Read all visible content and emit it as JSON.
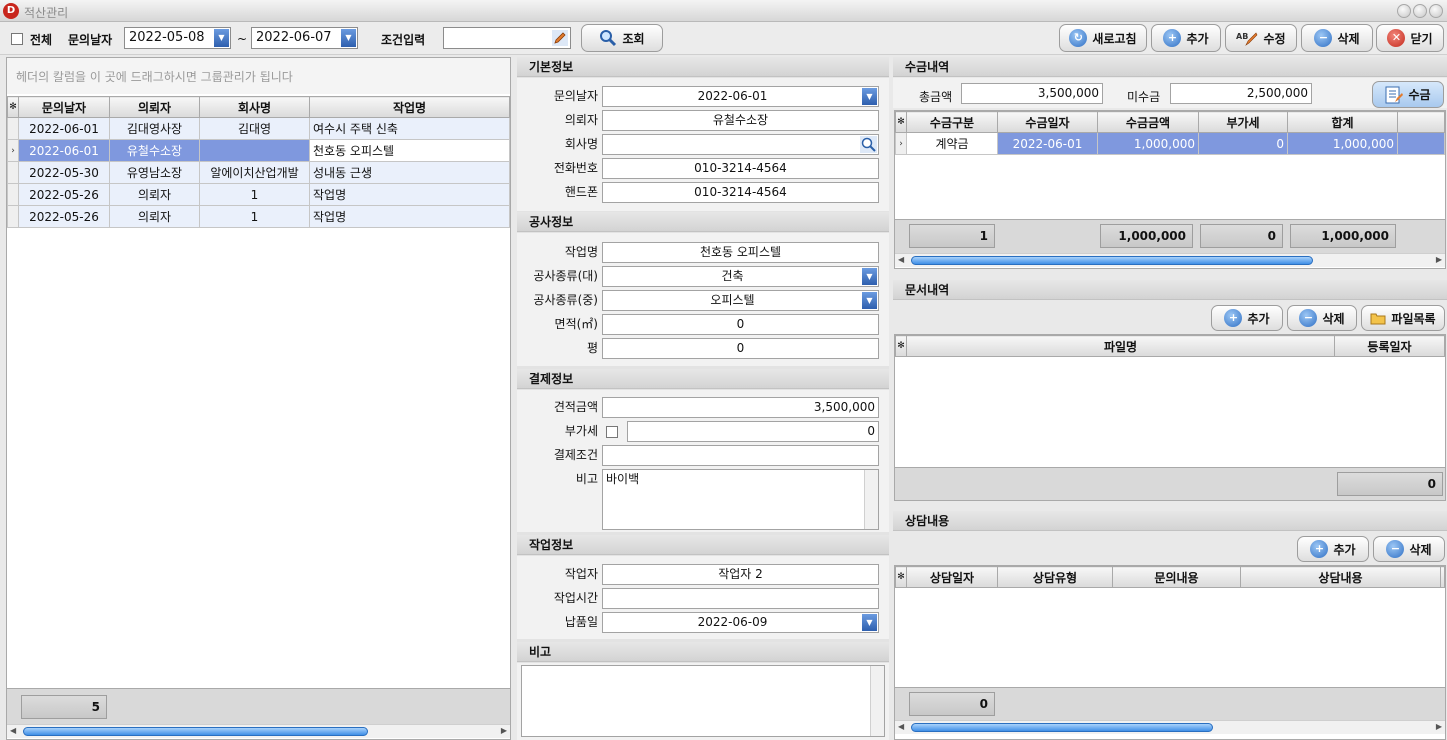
{
  "window": {
    "title": "적산관리",
    "app_letter": "D"
  },
  "toolbar": {
    "all_label": "전체",
    "date_label": "문의날자",
    "date_from": "2022-05-08",
    "tilde": "~",
    "date_to": "2022-06-07",
    "cond_label": "조건입력",
    "cond_value": "",
    "search_label": "조회",
    "refresh_label": "새로고침",
    "add_label": "추가",
    "edit_label": "수정",
    "delete_label": "삭제",
    "close_label": "닫기"
  },
  "left": {
    "group_hint": "헤더의 칼럼을 이 곳에 드래그하시면 그룹관리가 됩니다",
    "columns": [
      "문의날자",
      "의뢰자",
      "회사명",
      "작업명"
    ],
    "rows": [
      [
        "2022-06-01",
        "김대영사장",
        "김대영",
        "여수시 주택 신축"
      ],
      [
        "2022-06-01",
        "유철수소장",
        "",
        "천호동 오피스텔"
      ],
      [
        "2022-05-30",
        "유영남소장",
        "알에이치산업개발",
        "성내동 근생"
      ],
      [
        "2022-05-26",
        "의뢰자",
        "1",
        "작업명"
      ],
      [
        "2022-05-26",
        "의뢰자",
        "1",
        "작업명"
      ]
    ],
    "selected_index": 1,
    "count": "5"
  },
  "basic": {
    "header": "기본정보",
    "date_label": "문의날자",
    "date": "2022-06-01",
    "client_label": "의뢰자",
    "client": "유철수소장",
    "company_label": "회사명",
    "company": "",
    "phone_label": "전화번호",
    "phone": "010-3214-4564",
    "mobile_label": "핸드폰",
    "mobile": "010-3214-4564"
  },
  "construction": {
    "header": "공사정보",
    "job_label": "작업명",
    "job": "천호동 오피스텔",
    "type_major_label": "공사종류(대)",
    "type_major": "건축",
    "type_mid_label": "공사종류(중)",
    "type_mid": "오피스텔",
    "area_label": "면적(㎡)",
    "area": "0",
    "pyeong_label": "평",
    "pyeong": "0"
  },
  "payment": {
    "header": "결제정보",
    "estimate_label": "견적금액",
    "estimate": "3,500,000",
    "vat_label": "부가세",
    "vat": "0",
    "terms_label": "결제조건",
    "terms": "",
    "note_label": "비고",
    "note": "바이백"
  },
  "work": {
    "header": "작업정보",
    "worker_label": "작업자",
    "worker": "작업자 2",
    "time_label": "작업시간",
    "time": "",
    "delivery_label": "납품일",
    "delivery": "2022-06-09"
  },
  "remarks": {
    "header": "비고",
    "text": ""
  },
  "collection": {
    "header": "수금내역",
    "total_label": "총금액",
    "total": "3,500,000",
    "unpaid_label": "미수금",
    "unpaid": "2,500,000",
    "button_label": "수금",
    "columns": [
      "수금구분",
      "수금일자",
      "수금금액",
      "부가세",
      "합계"
    ],
    "rows": [
      [
        "계약금",
        "2022-06-01",
        "1,000,000",
        "0",
        "1,000,000"
      ]
    ],
    "footer": [
      "1",
      "1,000,000",
      "0",
      "1,000,000"
    ]
  },
  "documents": {
    "header": "문서내역",
    "add_label": "추가",
    "delete_label": "삭제",
    "filelist_label": "파일목록",
    "columns": [
      "파일명",
      "등록일자"
    ],
    "count": "0"
  },
  "consult": {
    "header": "상담내용",
    "add_label": "추가",
    "delete_label": "삭제",
    "columns": [
      "상담일자",
      "상담유형",
      "문의내용",
      "상담내용"
    ],
    "count": "0"
  },
  "colors": {
    "accent": "#2e5fae",
    "selection": "#7f98de",
    "close": "#c32a1d"
  }
}
